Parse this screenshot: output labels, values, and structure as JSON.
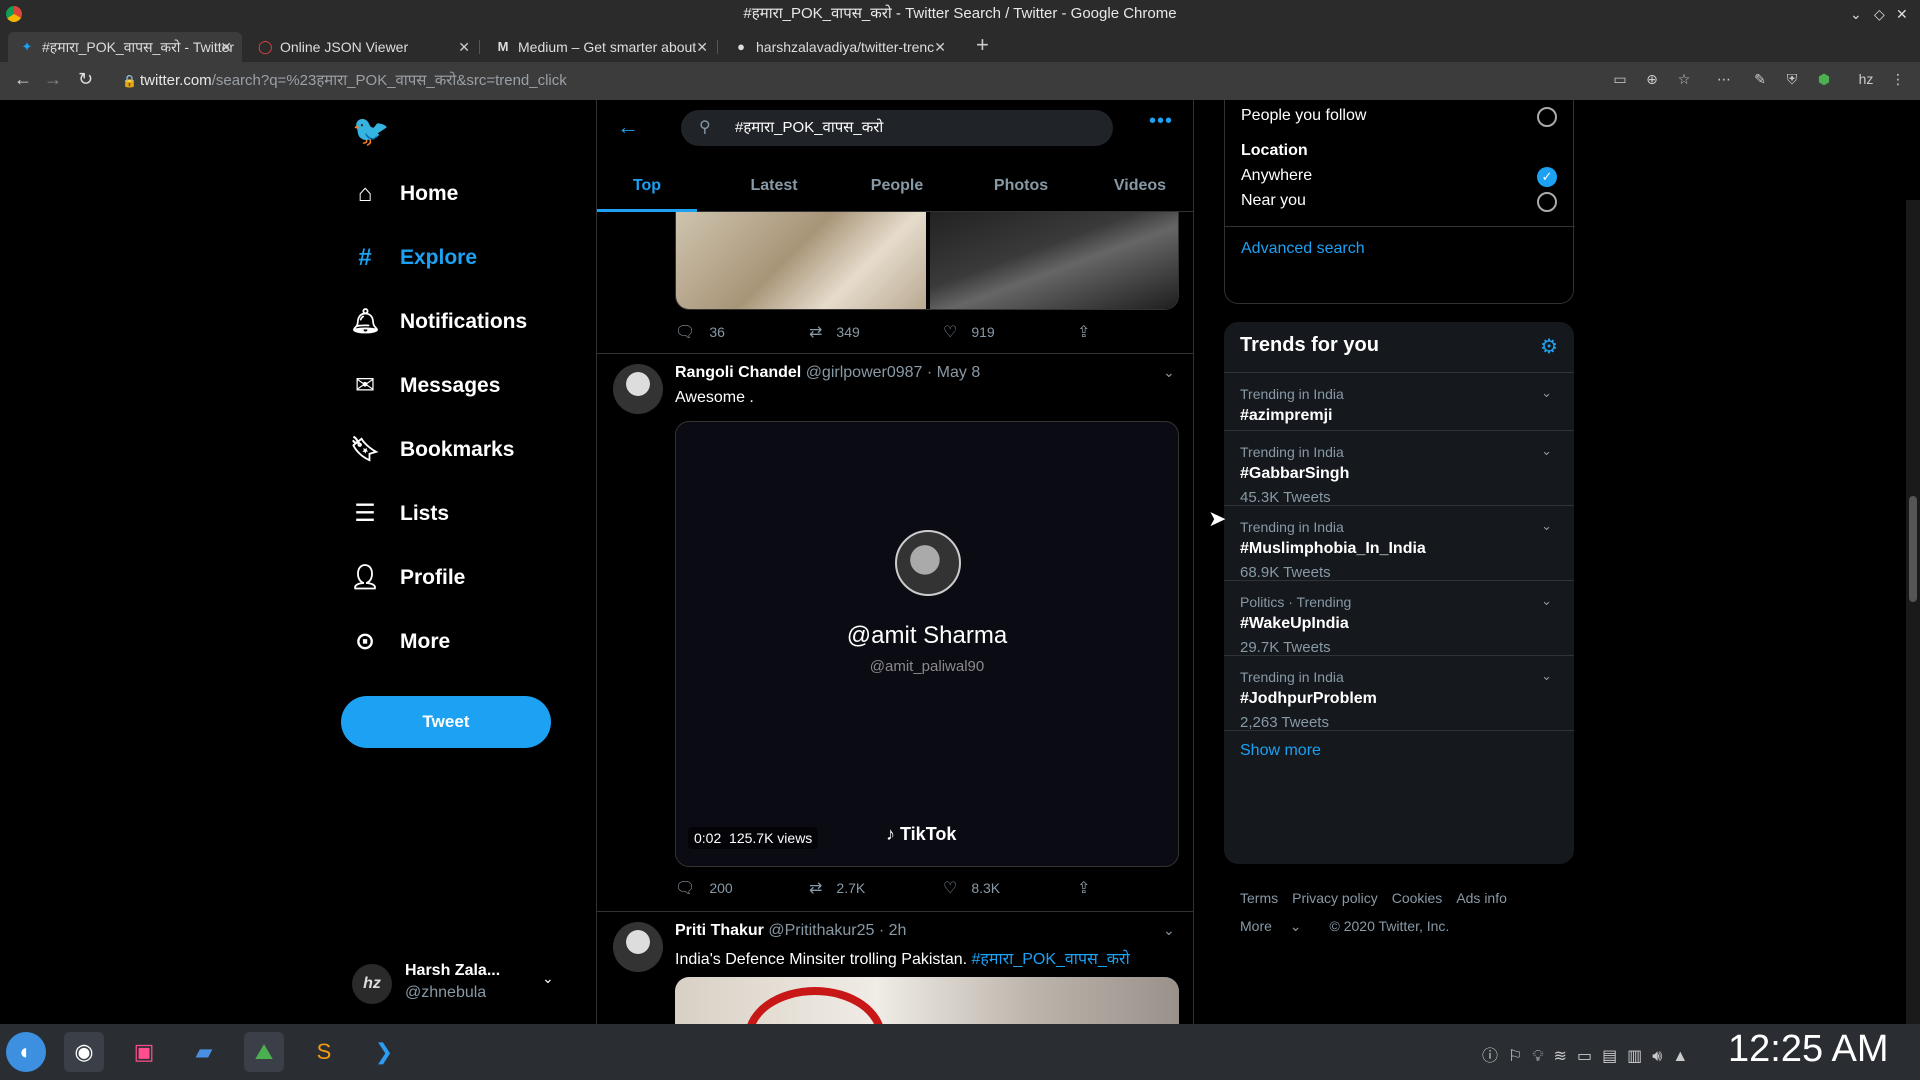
{
  "window": {
    "title": "#हमारा_POK_वापस_करो - Twitter Search / Twitter - Google Chrome"
  },
  "tabs": [
    {
      "label": "#हमारा_POK_वापस_करो - Twitter",
      "icon": "twitter-icon"
    },
    {
      "label": "Online JSON Viewer",
      "icon": "opera-icon"
    },
    {
      "label": "Medium – Get smarter about",
      "icon": "medium-icon"
    },
    {
      "label": "harshzalavadiya/twitter-trenc",
      "icon": "github-icon"
    }
  ],
  "address": {
    "host": "twitter.com",
    "path": "/search?q=%23हमारा_POK_वापस_करो&src=trend_click"
  },
  "nav": {
    "home": "Home",
    "explore": "Explore",
    "notifications": "Notifications",
    "messages": "Messages",
    "bookmarks": "Bookmarks",
    "lists": "Lists",
    "profile": "Profile",
    "more": "More",
    "tweet": "Tweet"
  },
  "account": {
    "name": "Harsh Zala...",
    "handle": "@zhnebula",
    "initials": "hz"
  },
  "search": {
    "query": "#हमारा_POK_वापस_करो",
    "tabs": [
      "Top",
      "Latest",
      "People",
      "Photos",
      "Videos"
    ],
    "active_tab": "Top"
  },
  "tweets": [
    {
      "replies": "36",
      "retweets": "349",
      "likes": "919"
    },
    {
      "name": "Rangoli Chandel",
      "handle": "@girlpower0987",
      "date": "· May 8",
      "text": "Awesome .",
      "video": {
        "title": "@amit Sharma",
        "handle": "@amit_paliwal90",
        "duration": "0:02",
        "views": "125.7K views",
        "brand": "TikTok"
      },
      "replies": "200",
      "retweets": "2.7K",
      "likes": "8.3K"
    },
    {
      "name": "Priti Thakur",
      "handle": "@Pritithakur25",
      "date": "· 2h",
      "text": "India's Defence Minsiter trolling Pakistan.",
      "hashtag": "#हमारा_POK_वापस_करो"
    }
  ],
  "filters": {
    "people_label": "People you follow",
    "location_heading": "Location",
    "anywhere": "Anywhere",
    "near_you": "Near you",
    "advanced": "Advanced search"
  },
  "trends": {
    "heading": "Trends for you",
    "items": [
      {
        "context": "Trending in India",
        "title": "#azimpremji",
        "count": ""
      },
      {
        "context": "Trending in India",
        "title": "#GabbarSingh",
        "count": "45.3K Tweets"
      },
      {
        "context": "Trending in India",
        "title": "#Muslimphobia_In_India",
        "count": "68.9K Tweets"
      },
      {
        "context": "Politics · Trending",
        "title": "#WakeUpIndia",
        "count": "29.7K Tweets"
      },
      {
        "context": "Trending in India",
        "title": "#JodhpurProblem",
        "count": "2,263 Tweets"
      }
    ],
    "show_more": "Show more"
  },
  "footer": {
    "terms": "Terms",
    "privacy": "Privacy policy",
    "cookies": "Cookies",
    "ads": "Ads info",
    "more": "More",
    "copyright": "© 2020 Twitter, Inc."
  },
  "taskbar": {
    "clock": "12:25 AM"
  },
  "colors": {
    "accent": "#1da1f2",
    "background": "#000000",
    "card": "#15181c"
  }
}
